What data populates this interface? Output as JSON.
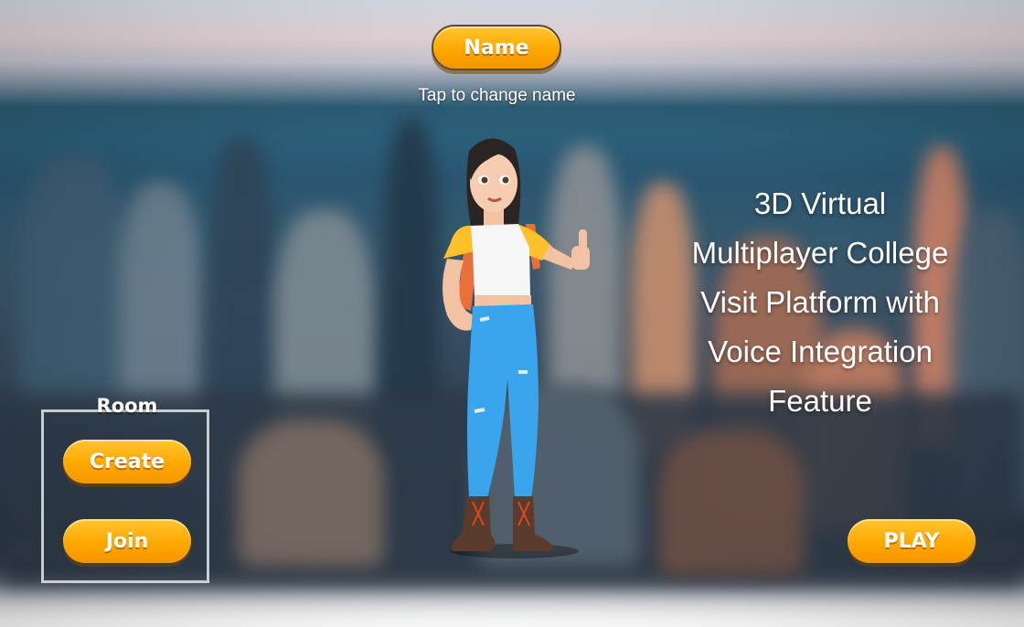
{
  "header": {
    "name_button_label": "Name",
    "tap_hint": "Tap to change name"
  },
  "headline": {
    "lines": [
      "3D Virtual",
      "Multiplayer College",
      "Visit Platform with",
      "Voice Integration",
      "Feature"
    ]
  },
  "room": {
    "label": "Room",
    "create_label": "Create",
    "join_label": "Join"
  },
  "play": {
    "label": "PLAY"
  },
  "colors": {
    "button_top": "#ffc532",
    "button_bottom": "#f59500",
    "text": "#ffffff"
  },
  "icons": {
    "avatar": "3d-character-girl-thumbs-up"
  }
}
